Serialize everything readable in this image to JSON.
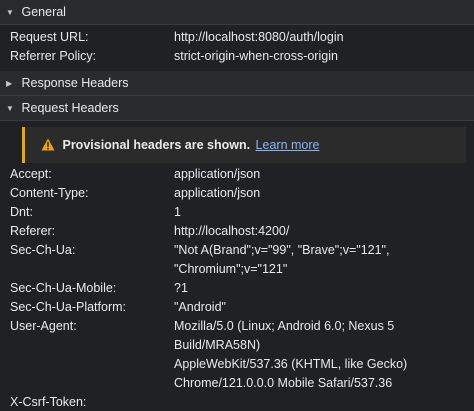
{
  "general": {
    "title": "General",
    "rows": [
      {
        "key": "Request URL:",
        "value": "http://localhost:8080/auth/login"
      },
      {
        "key": "Referrer Policy:",
        "value": "strict-origin-when-cross-origin"
      }
    ]
  },
  "response_headers": {
    "title": "Response Headers"
  },
  "request_headers": {
    "title": "Request Headers",
    "notice": {
      "text": "Provisional headers are shown.",
      "link": "Learn more",
      "accent": "#f0a500"
    },
    "rows": [
      {
        "key": "Accept:",
        "value": "application/json"
      },
      {
        "key": "Content-Type:",
        "value": "application/json"
      },
      {
        "key": "Dnt:",
        "value": "1"
      },
      {
        "key": "Referer:",
        "value": "http://localhost:4200/"
      },
      {
        "key": "Sec-Ch-Ua:",
        "value": "\"Not A(Brand\";v=\"99\", \"Brave\";v=\"121\",\n\"Chromium\";v=\"121\""
      },
      {
        "key": "Sec-Ch-Ua-Mobile:",
        "value": "?1"
      },
      {
        "key": "Sec-Ch-Ua-Platform:",
        "value": "\"Android\""
      },
      {
        "key": "User-Agent:",
        "value": "Mozilla/5.0 (Linux; Android 6.0; Nexus 5 Build/MRA58N)\nAppleWebKit/537.36 (KHTML, like Gecko)\nChrome/121.0.0.0 Mobile Safari/537.36"
      },
      {
        "key": "X-Csrf-Token:",
        "value": ""
      }
    ]
  },
  "icons": {
    "expanded": "triangle-down-icon",
    "collapsed": "triangle-right-icon",
    "warning": "warning-icon"
  },
  "colors": {
    "background": "#202124",
    "header_bg": "#2a2b2e",
    "link": "#8ab4f8",
    "warning": "#f0a500"
  }
}
